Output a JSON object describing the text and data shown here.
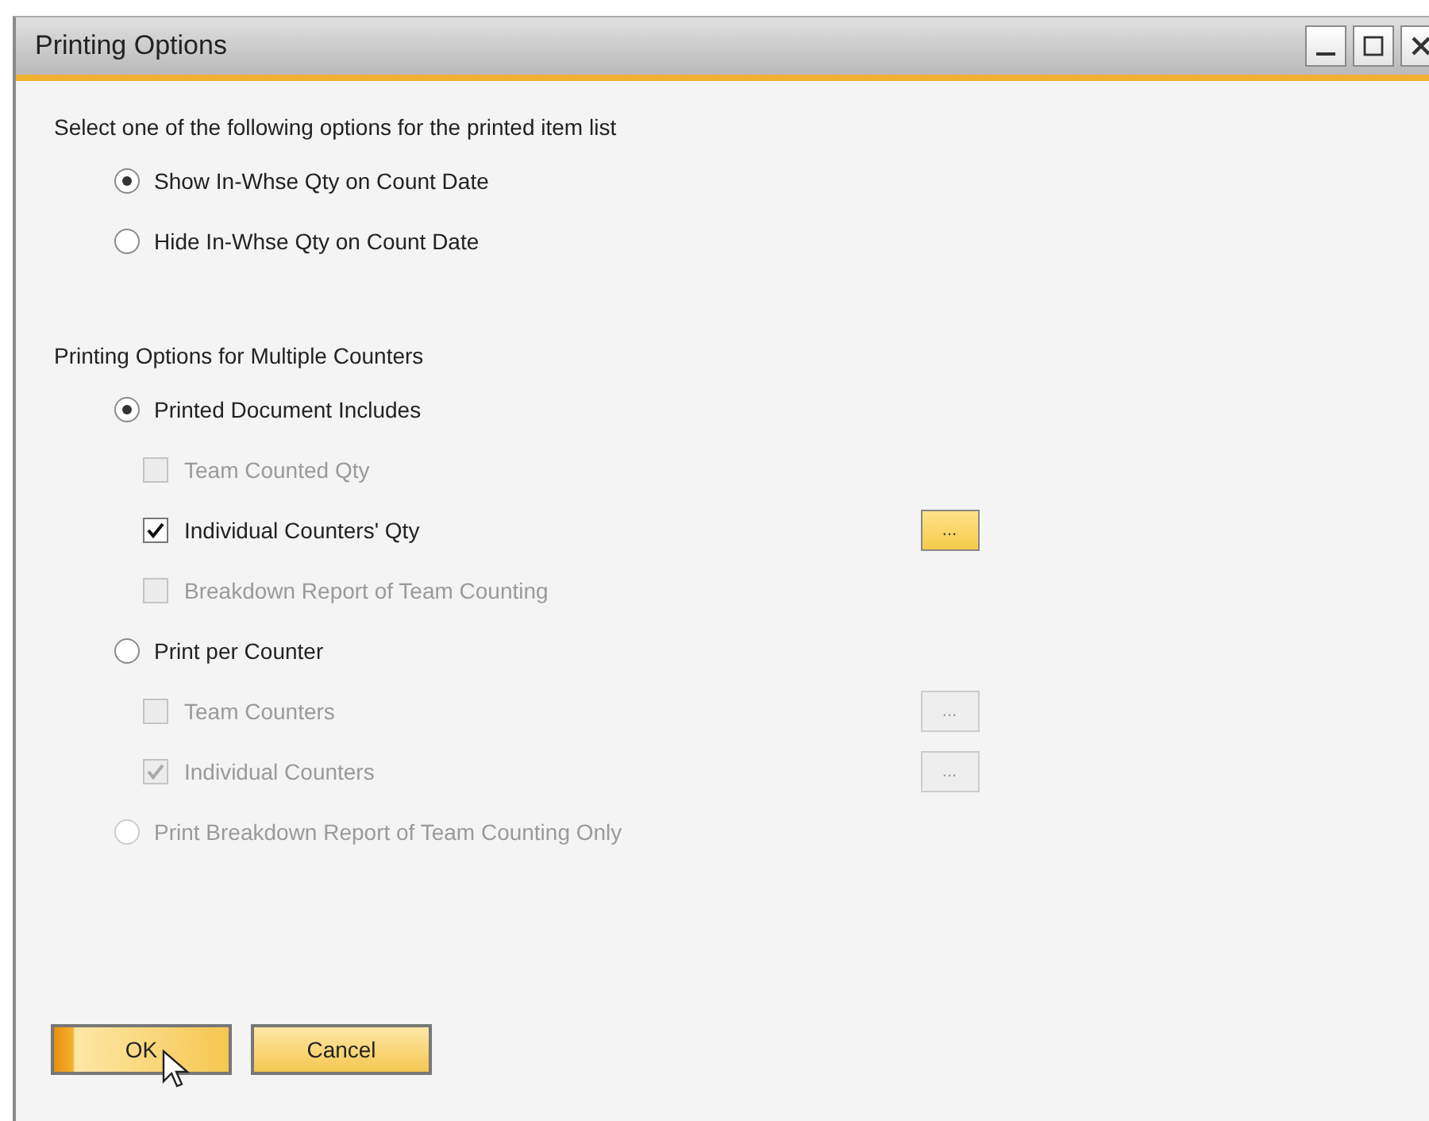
{
  "window": {
    "title": "Printing Options"
  },
  "title_buttons": [
    {
      "kind": "minimize"
    },
    {
      "kind": "maximize"
    },
    {
      "kind": "close"
    }
  ],
  "sections": [
    {
      "heading": "Select one of the following options for the printed item list",
      "options": [
        {
          "kind": "radio",
          "label": "Show In-Whse Qty on Count Date",
          "selected": true,
          "disabled": false
        },
        {
          "kind": "radio",
          "label": "Hide In-Whse Qty on Count Date",
          "selected": false,
          "disabled": false
        }
      ]
    },
    {
      "heading": "Printing Options for Multiple Counters",
      "options": [
        {
          "kind": "radio",
          "label": "Printed Document Includes",
          "selected": true,
          "disabled": false,
          "children": [
            {
              "kind": "checkbox",
              "label": "Team Counted Qty",
              "checked": false,
              "disabled": true
            },
            {
              "kind": "checkbox",
              "label": "Individual Counters' Qty",
              "checked": true,
              "disabled": false,
              "more_button": {
                "label": "...",
                "disabled": false
              }
            },
            {
              "kind": "checkbox",
              "label": "Breakdown Report of Team Counting",
              "checked": false,
              "disabled": true
            }
          ]
        },
        {
          "kind": "radio",
          "label": "Print per Counter",
          "selected": false,
          "disabled": false,
          "children": [
            {
              "kind": "checkbox",
              "label": "Team Counters",
              "checked": false,
              "disabled": true,
              "more_button": {
                "label": "...",
                "disabled": true
              }
            },
            {
              "kind": "checkbox",
              "label": "Individual Counters",
              "checked": true,
              "disabled": true,
              "more_button": {
                "label": "...",
                "disabled": true
              }
            }
          ]
        },
        {
          "kind": "radio",
          "label": "Print Breakdown Report of Team Counting Only",
          "selected": false,
          "disabled": true
        }
      ]
    }
  ],
  "buttons": [
    {
      "label": "OK",
      "focused": true
    },
    {
      "label": "Cancel",
      "focused": false
    }
  ]
}
